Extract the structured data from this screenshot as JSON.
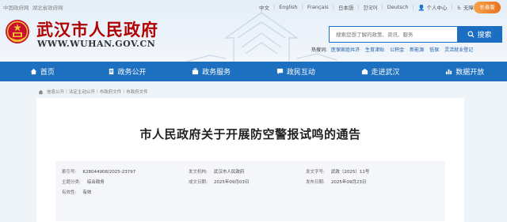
{
  "topbar": {
    "left_links": [
      "中国政府网",
      "湖北省政府网"
    ],
    "languages": [
      "中文",
      "English",
      "Français",
      "日本語",
      "한국어",
      "Deutsch"
    ],
    "personal_center": "个人中心",
    "accessibility": "无障碍",
    "elder_mode": "长者版"
  },
  "site": {
    "title": "武汉市人民政府",
    "url": "WWW.WUHAN.GOV.CN"
  },
  "search": {
    "placeholder": "搜索您想了解的政策、资讯、服务",
    "button_label": "搜索",
    "hot_label": "热搜词:",
    "hot_words": [
      "医保家庭共济",
      "生育津贴",
      "公积金",
      "新能源",
      "低保",
      "灵活就业登记"
    ]
  },
  "nav": {
    "items": [
      {
        "label": "首页",
        "icon": "home-icon"
      },
      {
        "label": "政务公开",
        "icon": "document-icon"
      },
      {
        "label": "政务服务",
        "icon": "service-icon"
      },
      {
        "label": "政民互动",
        "icon": "chat-icon"
      },
      {
        "label": "走进武汉",
        "icon": "building-icon"
      },
      {
        "label": "数据开放",
        "icon": "data-icon"
      }
    ]
  },
  "breadcrumb": [
    "信息公开",
    "法定主动公开",
    "市政府文件",
    "市政府文件"
  ],
  "document": {
    "title": "市人民政府关于开展防空警报试鸣的通告",
    "meta": {
      "index_no_label": "索引号:",
      "index_no": "K28044908/2025-23797",
      "category_label": "主题分类:",
      "category": "综合政务",
      "validity_label": "有效性:",
      "validity": "有效",
      "issuer_label": "发文机构:",
      "issuer": "武汉市人民政府",
      "created_label": "成文日期:",
      "created": "2025年09月03日",
      "doc_no_label": "发文字号:",
      "doc_no": "武政〔2025〕11号",
      "published_label": "发布日期:",
      "published": "2025年09月23日"
    }
  }
}
